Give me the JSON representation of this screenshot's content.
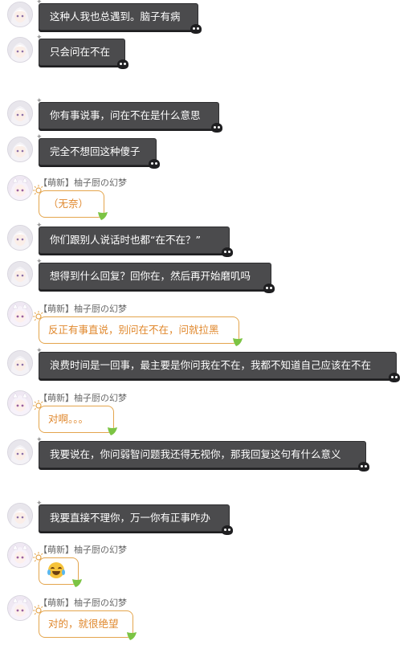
{
  "theme": {
    "dark_bubble": "#4b4b4d",
    "light_border": "#e4a54d",
    "light_text": "#e0882d"
  },
  "messages": [
    {
      "type": "dark",
      "text": "这种人我也总遇到。脑子有病"
    },
    {
      "type": "dark",
      "text": "只会问在不在"
    },
    {
      "type": "dark",
      "text": "你有事说事，问在不在是什么意思"
    },
    {
      "type": "dark",
      "text": "完全不想回这种傻子"
    },
    {
      "type": "light",
      "sender": "【萌新】柚子厨の幻梦",
      "text": "（无奈）"
    },
    {
      "type": "dark",
      "text": "你们跟别人说话时也都“在不在？”"
    },
    {
      "type": "dark",
      "text": "想得到什么回复？回你在，然后再开始磨叽吗"
    },
    {
      "type": "light",
      "sender": "【萌新】柚子厨の幻梦",
      "text": "反正有事直说，别问在不在，问就拉黑"
    },
    {
      "type": "dark",
      "text": "浪费时间是一回事，最主要是你问我在不在，我都不知道自己应该在不在"
    },
    {
      "type": "light",
      "sender": "【萌新】柚子厨の幻梦",
      "text": "对啊。。。"
    },
    {
      "type": "dark",
      "text": "我要说在，你问弱智问题我还得无视你，那我回复这句有什么意义"
    },
    {
      "type": "dark",
      "text": "我要直接不理你，万一你有正事咋办"
    },
    {
      "type": "light",
      "sender": "【萌新】柚子厨の幻梦",
      "text": "",
      "emoji": "joy-tears-emoji"
    },
    {
      "type": "light",
      "sender": "【萌新】柚子厨の幻梦",
      "text": "对的，就很绝望"
    }
  ]
}
